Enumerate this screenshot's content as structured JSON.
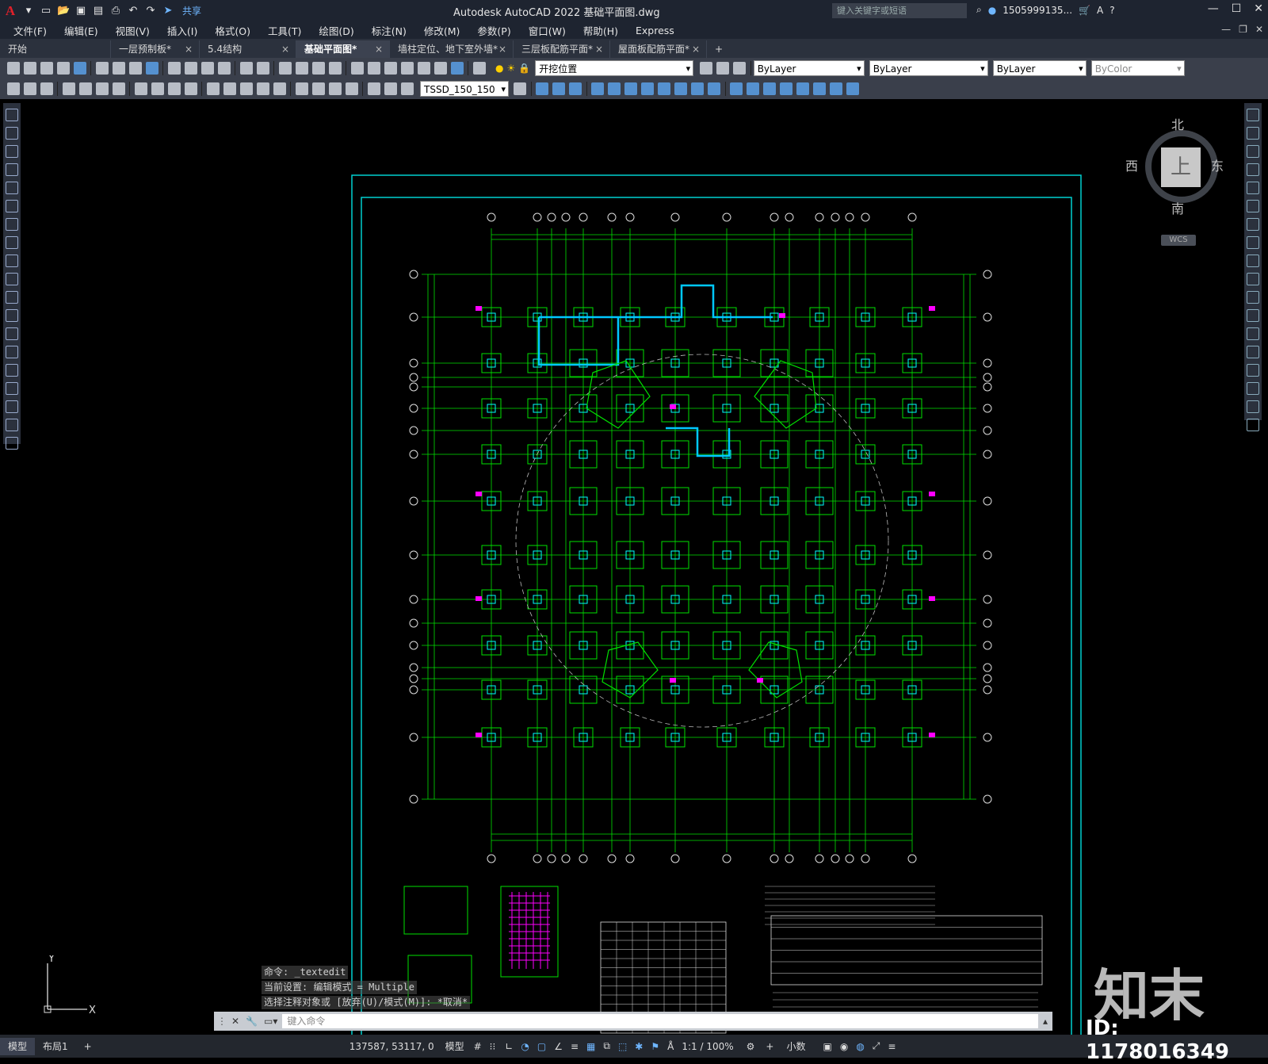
{
  "app": {
    "title": "Autodesk AutoCAD 2022    基础平面图.dwg",
    "share_label": "共享",
    "search_placeholder": "键入关键字或短语",
    "user": "1505999135...",
    "logo": "A"
  },
  "menu": [
    "文件(F)",
    "编辑(E)",
    "视图(V)",
    "插入(I)",
    "格式(O)",
    "工具(T)",
    "绘图(D)",
    "标注(N)",
    "修改(M)",
    "参数(P)",
    "窗口(W)",
    "帮助(H)",
    "Express"
  ],
  "tabs": [
    {
      "label": "开始",
      "close": ""
    },
    {
      "label": "一层预制板*",
      "close": "×"
    },
    {
      "label": "5.4结构",
      "close": "×"
    },
    {
      "label": "基础平面图*",
      "close": "×",
      "active": true
    },
    {
      "label": "墙柱定位、地下室外墙*",
      "close": "×"
    },
    {
      "label": "三层板配筋平面*",
      "close": "×"
    },
    {
      "label": "屋面板配筋平面*",
      "close": "×"
    },
    {
      "label": "+",
      "close": ""
    }
  ],
  "toolbar": {
    "layer_value": "开挖位置",
    "color_value": "ByLayer",
    "linetype_value": "ByLayer",
    "lineweight_value": "ByLayer",
    "plotstyle_value": "ByColor",
    "textstyle_value": "TSSD_150_150"
  },
  "viewcube": {
    "north": "北",
    "south": "南",
    "east": "东",
    "west": "西",
    "top": "上",
    "wcs": "WCS"
  },
  "command": {
    "history": [
      "命令: _textedit",
      "当前设置: 编辑模式 = Multiple",
      "选择注释对象或 [放弃(U)/模式(M)]: *取消*"
    ],
    "placeholder": "键入命令"
  },
  "status": {
    "layouts": [
      "模型",
      "布局1",
      "+"
    ],
    "coords": "137587, 53117, 0",
    "space": "模型",
    "scale": "1:1 / 100%",
    "units": "小数"
  },
  "overlay": {
    "brand": "知末",
    "id": "ID: 1178016349"
  }
}
